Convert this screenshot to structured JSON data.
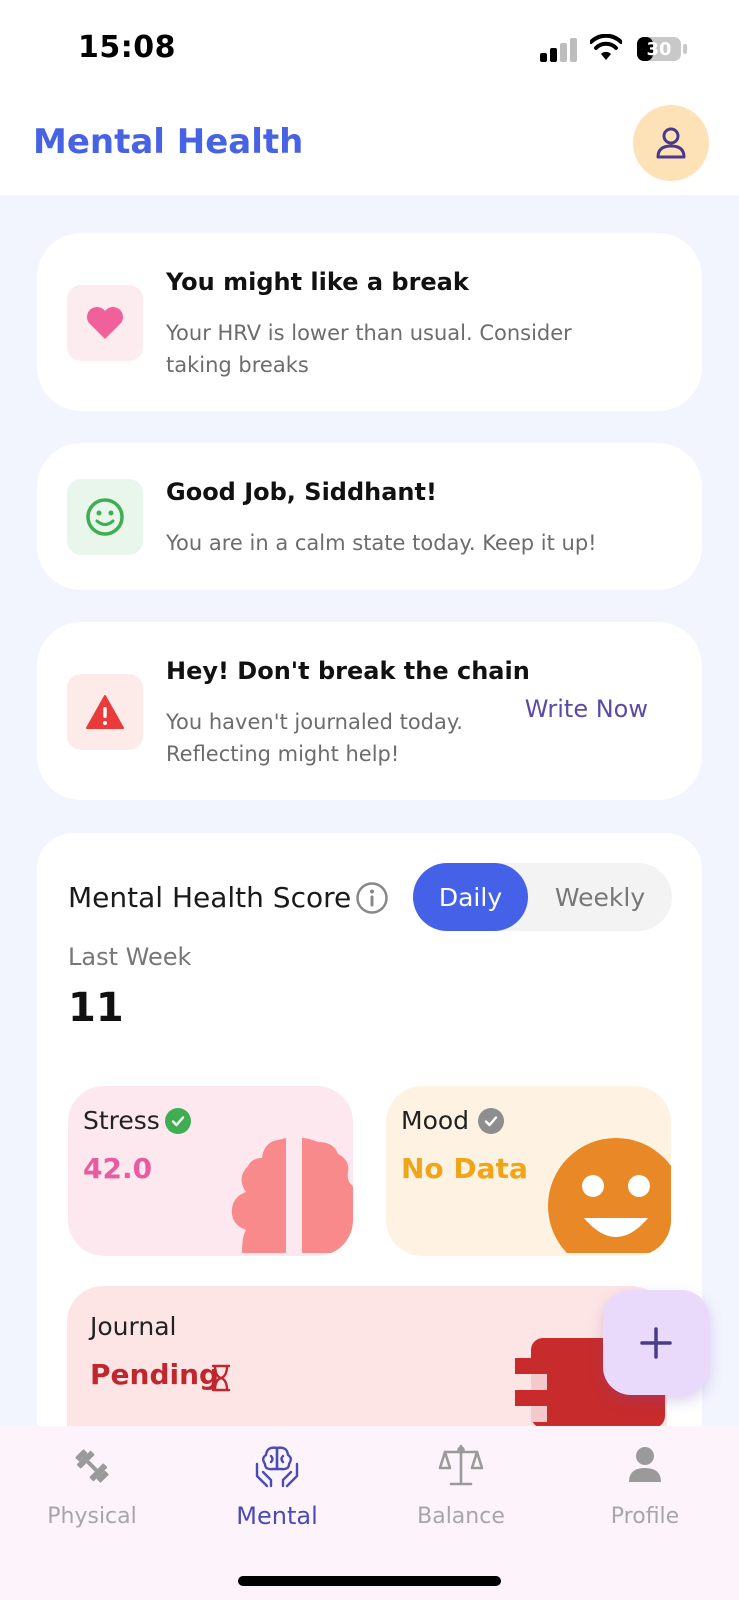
{
  "status_bar": {
    "time": "15:08",
    "battery": "30"
  },
  "header": {
    "title": "Mental Health",
    "avatar_icon": "user-icon"
  },
  "cards": [
    {
      "title": "You might like a break",
      "description": "Your HRV is lower than usual. Consider taking breaks",
      "icon": "heart-icon",
      "accent": "#f0609a",
      "icon_bg": "#fdecef"
    },
    {
      "title": "Good Job, Siddhant!",
      "description": "You are in a calm state today. Keep it up!",
      "icon": "smile-icon",
      "accent": "#3fae52",
      "icon_bg": "#e9f6ec"
    },
    {
      "title": "Hey! Don't break the chain",
      "description": "You haven't journaled today. Reflecting might help!",
      "icon": "warning-icon",
      "accent": "#ea3a3a",
      "icon_bg": "#fdebea",
      "action": "Write Now"
    }
  ],
  "score": {
    "title": "Mental Health Score",
    "toggle": {
      "daily": "Daily",
      "weekly": "Weekly",
      "selected": "Daily"
    },
    "period": "Last Week",
    "value": "11"
  },
  "tiles": {
    "stress": {
      "label": "Stress",
      "value": "42.0",
      "color": "#ea5a9e",
      "bg": "#fde8ef"
    },
    "mood": {
      "label": "Mood",
      "value": "No Data",
      "color": "#f0a418",
      "bg": "#fef3e3"
    }
  },
  "journal": {
    "label": "Journal",
    "value": "Pending"
  },
  "fab": {
    "icon": "plus-icon"
  },
  "nav": [
    {
      "label": "Physical",
      "icon": "dumbbell-icon",
      "active": false
    },
    {
      "label": "Mental",
      "icon": "brain-hands-icon",
      "active": true
    },
    {
      "label": "Balance",
      "icon": "scale-icon",
      "active": false
    },
    {
      "label": "Profile",
      "icon": "person-icon",
      "active": false
    }
  ],
  "colors": {
    "primary": "#4561e8",
    "background": "#f2f4fe",
    "accent_purple": "#5b4ba8"
  }
}
